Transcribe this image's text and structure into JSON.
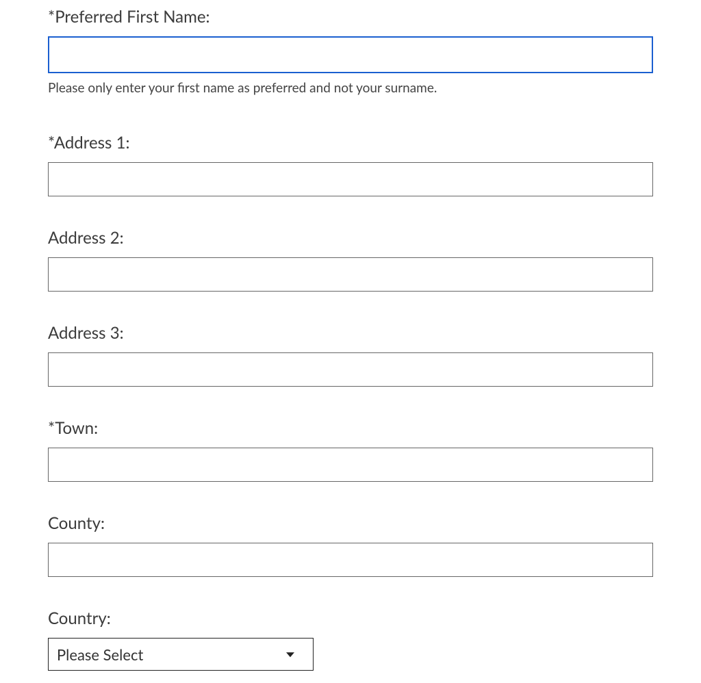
{
  "form": {
    "preferred_first_name": {
      "label": "*Preferred First Name:",
      "value": "",
      "help": "Please only enter your first name as preferred and not your surname."
    },
    "address1": {
      "label": "*Address 1:",
      "value": ""
    },
    "address2": {
      "label": "Address 2:",
      "value": ""
    },
    "address3": {
      "label": "Address 3:",
      "value": ""
    },
    "town": {
      "label": "*Town:",
      "value": ""
    },
    "county": {
      "label": "County:",
      "value": ""
    },
    "country": {
      "label": "Country:",
      "selected": "Please Select"
    }
  }
}
